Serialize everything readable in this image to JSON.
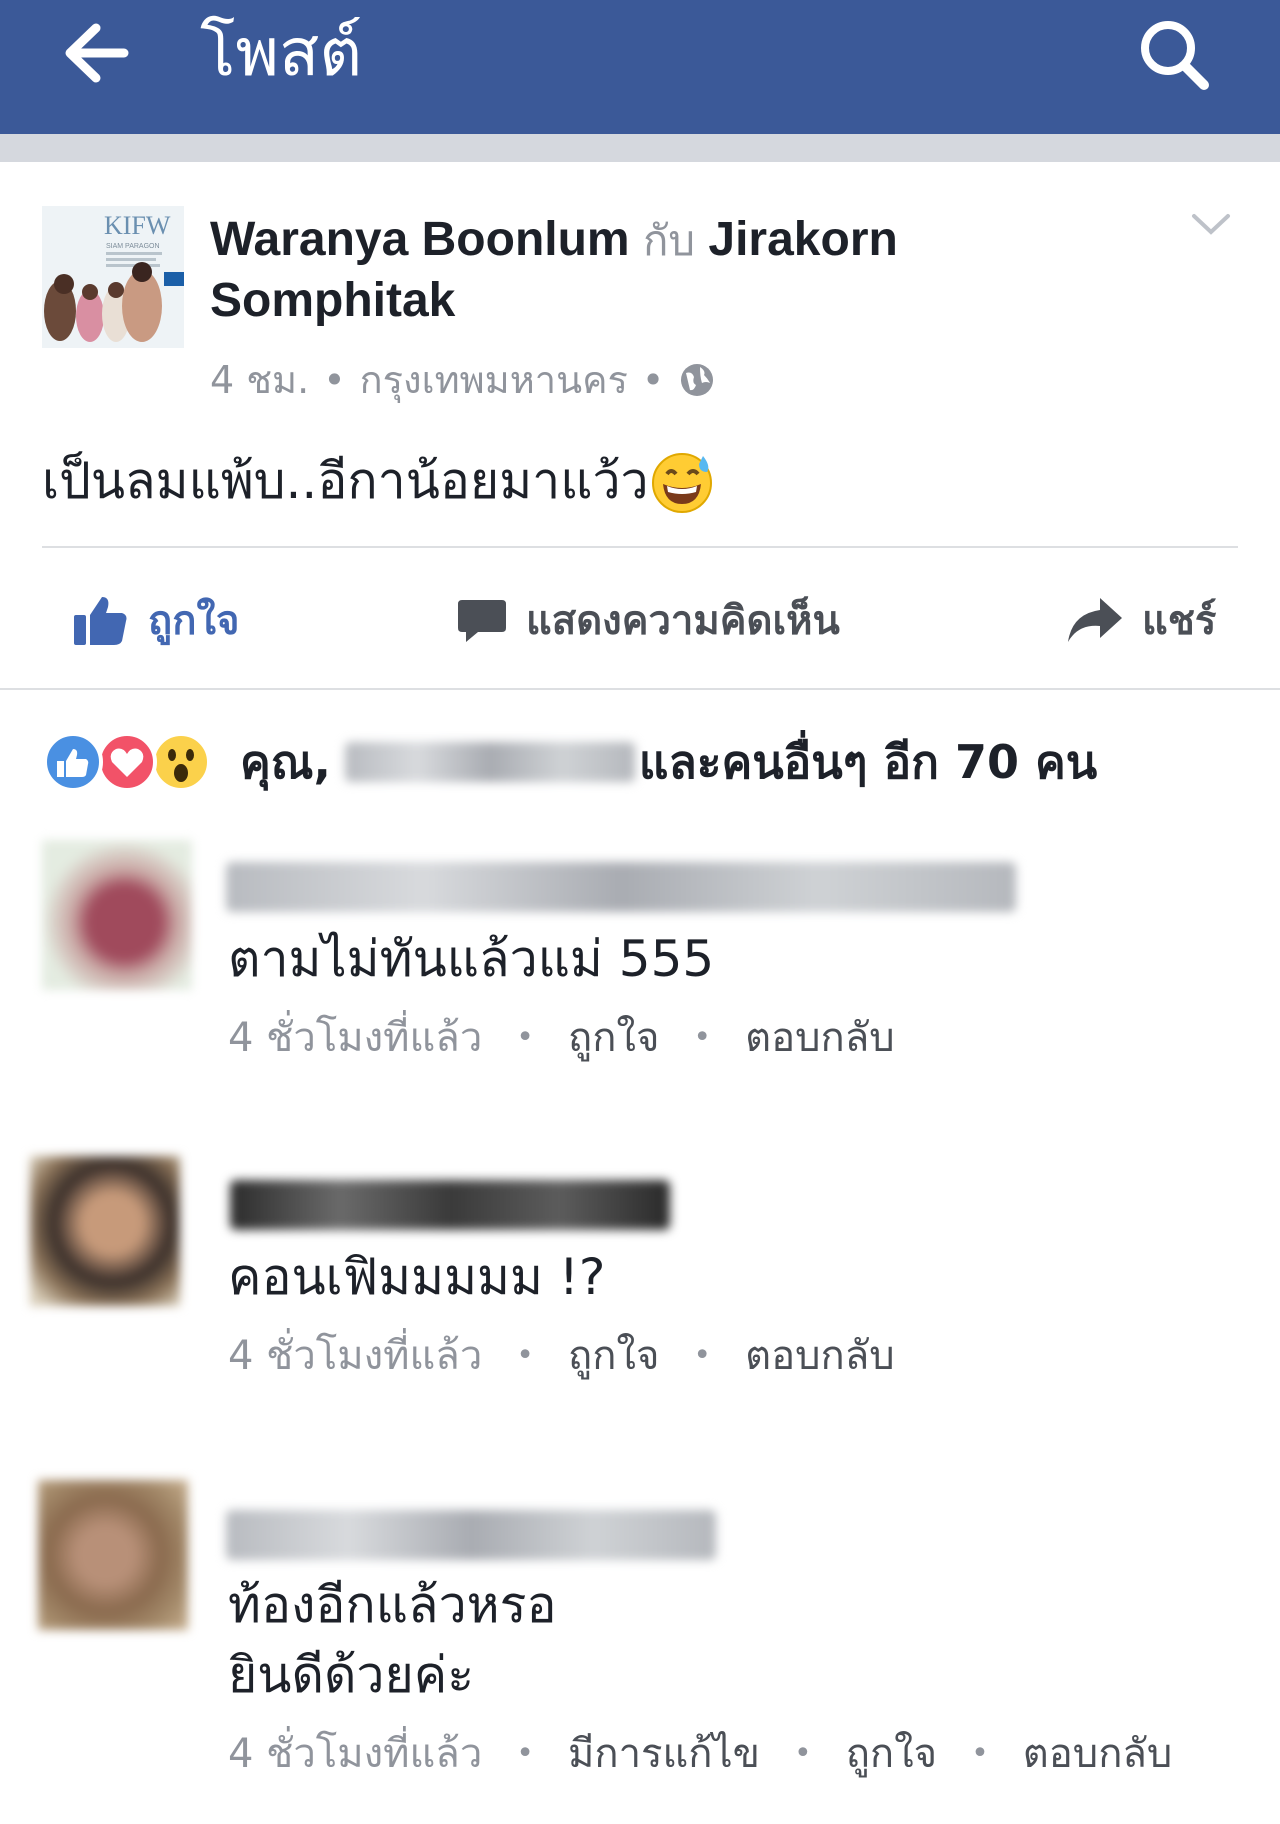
{
  "header": {
    "title": "โพสต์",
    "back_icon": "arrow-left-icon",
    "search_icon": "search-icon",
    "bar_color": "#3b5998"
  },
  "post": {
    "thumbnail_text": "KIFW",
    "thumbnail_sub": "SIAM PARAGON",
    "author": "Waranya Boonlum",
    "with_word": "กับ",
    "tagged": "Jirakorn Somphitak",
    "time": "4 ชม.",
    "location": "กรุงเทพมหานคร",
    "privacy_icon": "globe-icon",
    "text": "เป็นลมแพ้บ..อีกาน้อยมาแว้ว",
    "emoji": "grinning-sweat-emoji"
  },
  "actions": {
    "like": "ถูกใจ",
    "comment": "แสดงความคิดเห็น",
    "share": "แชร์",
    "like_color": "#4267b2",
    "text_color": "#4b4f56"
  },
  "reactions": {
    "icons": [
      "like-reaction-icon",
      "love-reaction-icon",
      "wow-reaction-icon"
    ],
    "prefix": "คุณ,",
    "suffix": "และคนอื่นๆ อีก 70 คน"
  },
  "comments": [
    {
      "text_lines": [
        "ตามไม่ทันแล้วแม่ 555"
      ],
      "time": "4 ชั่วโมงที่แล้ว",
      "actions": [
        "ถูกใจ",
        "ตอบกลับ"
      ]
    },
    {
      "text_lines": [
        "คอนเฟิมมมมม !?"
      ],
      "time": "4 ชั่วโมงที่แล้ว",
      "actions": [
        "ถูกใจ",
        "ตอบกลับ"
      ]
    },
    {
      "text_lines": [
        "ท้องอีกแล้วหรอ",
        "ยินดีด้วยค่ะ"
      ],
      "time": "4 ชั่วโมงที่แล้ว",
      "actions": [
        "มีการแก้ไข",
        "ถูกใจ",
        "ตอบกลับ"
      ]
    }
  ]
}
